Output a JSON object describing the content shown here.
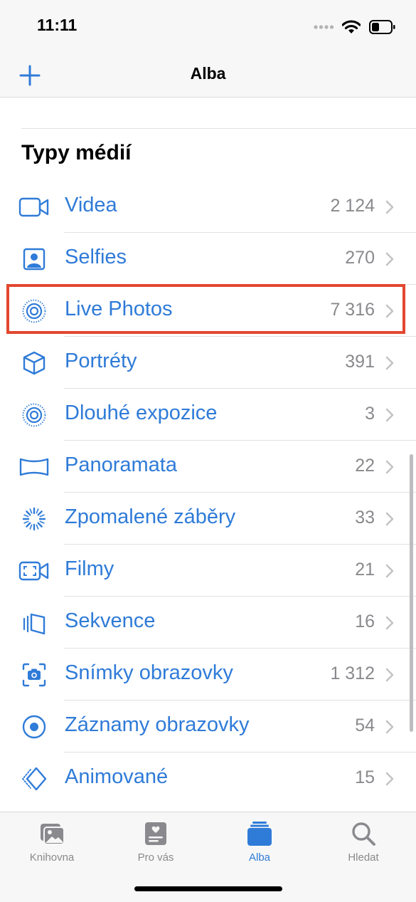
{
  "status_bar": {
    "time": "11:11",
    "icons": [
      "cellular-signal-icon",
      "wifi-icon",
      "battery-icon"
    ]
  },
  "nav": {
    "title": "Alba",
    "add_icon": "plus-icon"
  },
  "section": {
    "title": "Typy médií"
  },
  "media_types": [
    {
      "label": "Videa",
      "count": "2 124",
      "icon": "video-camera-icon"
    },
    {
      "label": "Selfies",
      "count": "270",
      "icon": "selfie-portrait-icon"
    },
    {
      "label": "Live Photos",
      "count": "7 316",
      "icon": "live-photo-icon",
      "highlighted": true
    },
    {
      "label": "Portréty",
      "count": "391",
      "icon": "cube-icon"
    },
    {
      "label": "Dlouhé expozice",
      "count": "3",
      "icon": "long-exposure-icon"
    },
    {
      "label": "Panoramata",
      "count": "22",
      "icon": "panorama-icon"
    },
    {
      "label": "Zpomalené záběry",
      "count": "33",
      "icon": "slow-motion-icon"
    },
    {
      "label": "Filmy",
      "count": "21",
      "icon": "cinematic-camera-icon"
    },
    {
      "label": "Sekvence",
      "count": "16",
      "icon": "burst-icon"
    },
    {
      "label": "Snímky obrazovky",
      "count": "1 312",
      "icon": "screenshot-icon"
    },
    {
      "label": "Záznamy obrazovky",
      "count": "54",
      "icon": "screen-recording-icon"
    },
    {
      "label": "Animované",
      "count": "15",
      "icon": "animated-icon"
    }
  ],
  "tabs": [
    {
      "label": "Knihovna",
      "icon": "photo-library-icon",
      "active": false
    },
    {
      "label": "Pro vás",
      "icon": "for-you-icon",
      "active": false
    },
    {
      "label": "Alba",
      "icon": "albums-icon",
      "active": true
    },
    {
      "label": "Hledat",
      "icon": "search-icon",
      "active": false
    }
  ],
  "colors": {
    "accent": "#2f7bd8",
    "secondary_text": "#8a8a8e",
    "highlight_border": "#e2472f",
    "bar_background": "#f7f7f7"
  }
}
